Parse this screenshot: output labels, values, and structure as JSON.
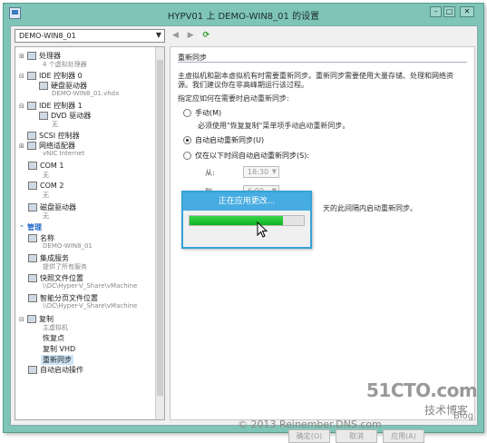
{
  "window": {
    "title": "HYPV01 上 DEMO-WIN8_01 的设置",
    "controls": [
      "–",
      "□",
      "✕"
    ]
  },
  "vm_selector": {
    "value": "DEMO-WIN8_01"
  },
  "nav": {
    "back": "◀",
    "forward": "▶",
    "refresh": "⟳"
  },
  "tree": {
    "processor": {
      "label": "处理器",
      "sub": "4 个虚拟处理器"
    },
    "ide0": {
      "label": "IDE 控制器 0"
    },
    "hdd": {
      "label": "硬盘驱动器",
      "sub": "DEMO-WIN8_01.vhdx"
    },
    "ide1": {
      "label": "IDE 控制器 1"
    },
    "dvd": {
      "label": "DVD 驱动器",
      "sub": "无"
    },
    "scsi": {
      "label": "SCSI 控制器"
    },
    "nic": {
      "label": "网络适配器",
      "sub": "vNIC Internet"
    },
    "com1": {
      "label": "COM 1",
      "sub": "无"
    },
    "com2": {
      "label": "COM 2",
      "sub": "无"
    },
    "floppy": {
      "label": "磁盘驱动器",
      "sub": "无"
    },
    "management": {
      "label": "管理"
    },
    "name": {
      "label": "名称",
      "sub": "DEMO-WIN8_01"
    },
    "integration": {
      "label": "集成服务",
      "sub": "提供了所有服务"
    },
    "snapshot": {
      "label": "快照文件位置",
      "sub": "\\\\DC\\Hyper-V_Share\\vMachine"
    },
    "paging": {
      "label": "智能分页文件位置",
      "sub": "\\\\DC\\Hyper-V_Share\\vMachine"
    },
    "replication": {
      "label": "复制",
      "sub": "主虚拟机"
    },
    "recovery": {
      "label": "恢复点"
    },
    "replvhd": {
      "label": "复制 VHD"
    },
    "resync": {
      "label": "重新同步"
    },
    "autostart": {
      "label": "自动启动操作"
    }
  },
  "pane": {
    "heading": "重新同步",
    "description": "主虚拟机和副本虚拟机有时需要重新同步。重新同步需要使用大量存储、处理和网络资源。我们建议你在非高峰期运行该过程。",
    "prompt": "指定应如何在需要时启动重新同步:",
    "manual": "手动(M)",
    "manual_hint": "必须使用\"恢复复制\"菜单项手动启动重新同步。",
    "auto": "自动启动重新同步(U)",
    "scheduled": "仅在以下时间自动启动重新同步(S):",
    "from_label": "从:",
    "from_value": "18:30",
    "to_label": "到:",
    "to_value": "6:00",
    "schedule_hint": "天的此间隔内启动重新同步。"
  },
  "progress_dialog": {
    "title": "正在应用更改...",
    "progress": 0.82
  },
  "footer": {
    "ok": "确定(O)",
    "cancel": "取消",
    "apply": "应用(A)"
  },
  "watermarks": {
    "brand": "51CTO.com",
    "blog_tag": "技术博客",
    "blog": "Blog",
    "copyright": "© 2013 Reinember.DNS.com"
  },
  "colors": {
    "titlebar": "#7ec5b7",
    "dialog_title": "#47ace1",
    "progress_fill": "#1bc02f",
    "section": "#1d63c5"
  }
}
